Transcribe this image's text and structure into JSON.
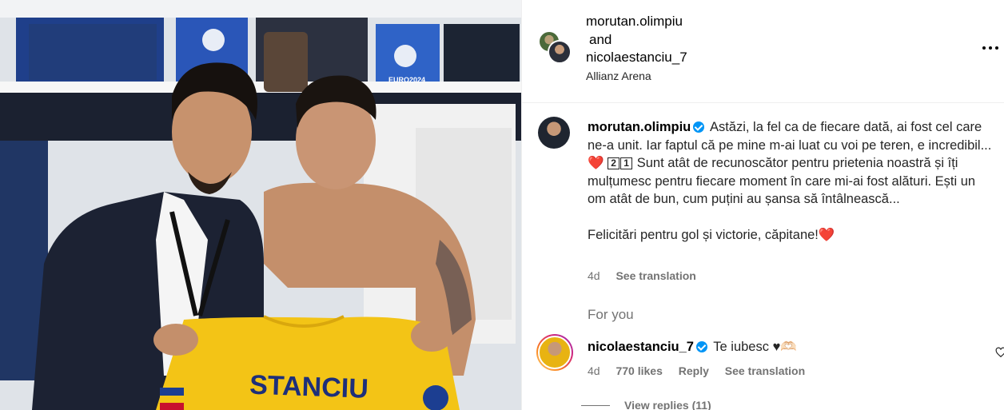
{
  "photo": {
    "shirt_name": "STANCIU",
    "locker_badge": "EURO2024"
  },
  "header": {
    "user1": "morutan.olimpiu",
    "and": "and",
    "user2": "nicolaestanciu_7",
    "location": "Allianz Arena"
  },
  "caption": {
    "username": "morutan.olimpiu",
    "line1": "Astăzi, la fel ca de fiecare dată, ai fost cel care ne-a unit. Iar faptul că pe mine m-ai luat cu voi pe teren, e incredibil...",
    "heart": "❤️",
    "digit1": "2",
    "digit2": "1",
    "line2": " Sunt atât de recunoscător pentru prietenia noastră și îți mulțumesc pentru fiecare moment în care mi-ai fost alături. Ești un om atât de bun, cum puțini au șansa să întâlnească...",
    "line3": "Felicitări pentru gol și victorie, căpitane!",
    "heart2": "❤️",
    "age": "4d",
    "see_translation": "See translation"
  },
  "for_you": "For you",
  "comment": {
    "username": "nicolaestanciu_7",
    "text": "Te iubesc",
    "emoji": "♥🫶🏻",
    "age": "4d",
    "likes": "770 likes",
    "reply": "Reply",
    "see_translation": "See translation",
    "view_replies": "View replies (11)"
  },
  "colors": {
    "verified": "#0095f6",
    "muted": "#737373",
    "jersey": "#f3c416",
    "heart": "#e0245e"
  }
}
